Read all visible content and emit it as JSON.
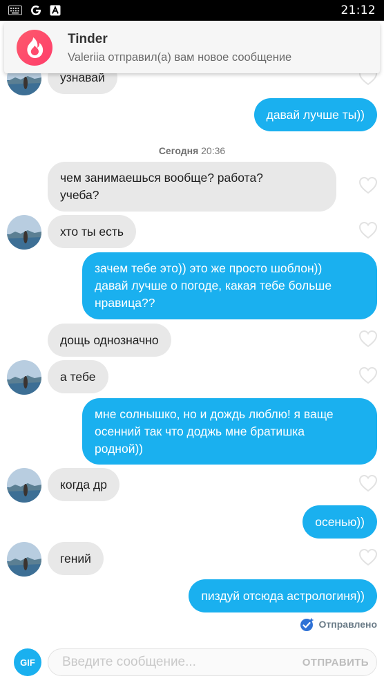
{
  "status_bar": {
    "time": "21:12",
    "icons": [
      "keyboard-icon",
      "google-g-icon",
      "a-box-icon"
    ]
  },
  "notification": {
    "app_name": "Tinder",
    "text": "Valeriia отправил(а) вам новое сообщение",
    "brand_color": "#fe4f6b"
  },
  "chat": {
    "date_day": "Сегодня",
    "date_time": "20:36",
    "messages": [
      {
        "dir": "in",
        "text": "узнавай"
      },
      {
        "dir": "out",
        "text": "давай лучше ты))"
      },
      {
        "dir": "in",
        "text": "чем занимаешься вообще? работа?\nучеба?"
      },
      {
        "dir": "in",
        "text": "хто ты есть"
      },
      {
        "dir": "out",
        "text": "зачем тебе это)) это же просто шоблон))\nдавай лучше о погоде, какая тебе больше\nнравица??"
      },
      {
        "dir": "in",
        "text": "дощь однозначно"
      },
      {
        "dir": "in",
        "text": "а тебе"
      },
      {
        "dir": "out",
        "text": "мне солнышко, но и дождь люблю! я ваще\nосенний так что доджь мне братишка\nродной))"
      },
      {
        "dir": "in",
        "text": "когда др"
      },
      {
        "dir": "out",
        "text": "осенью))"
      },
      {
        "dir": "in",
        "text": "гений"
      },
      {
        "dir": "out",
        "text": "пиздуй отсюда астрологиня))"
      }
    ],
    "sent_status": "Отправлено"
  },
  "composer": {
    "gif_label": "GIF",
    "placeholder": "Введите сообщение...",
    "send_label": "ОТПРАВИТЬ"
  },
  "colors": {
    "outgoing_bubble": "#1ab0ef",
    "incoming_bubble": "#e8e8e8"
  }
}
